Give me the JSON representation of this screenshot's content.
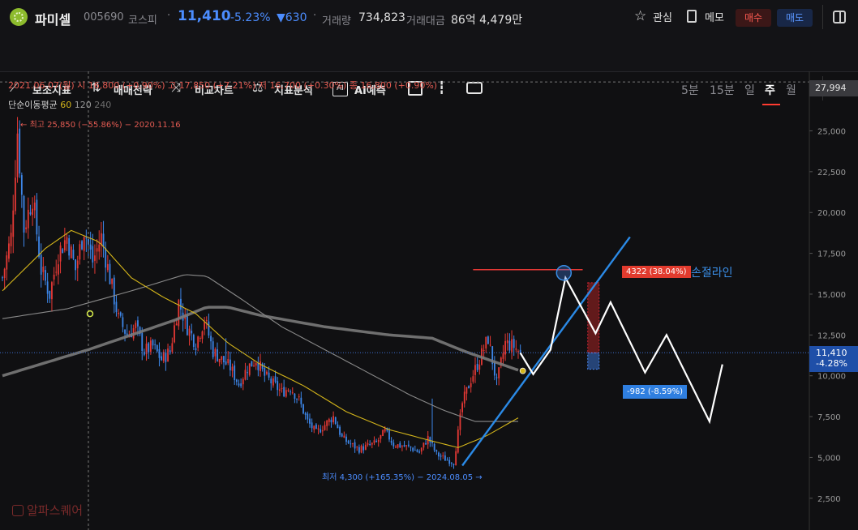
{
  "header": {
    "name": "파미셀",
    "code": "005690",
    "market": "코스피",
    "price": "11,410",
    "change_pct": "-5.23%",
    "change_abs": "▼630",
    "volume_label": "거래량",
    "volume": "734,823",
    "amount_label": "거래대금",
    "amount": "86억 4,479만",
    "watch_label": "관심",
    "memo_label": "메모",
    "buy_label": "매수",
    "sell_label": "매도"
  },
  "toolbar": {
    "items": [
      "보조지표",
      "매매전략",
      "비교차트",
      "지표분석",
      "AI예측"
    ],
    "periods": [
      "5분",
      "15분",
      "일",
      "주",
      "월"
    ],
    "active_period": "주"
  },
  "legend": {
    "ohlc": "2021.06.07(월)  시 16,800 (+0.90%)  고 17,850 (+7.21%)  저 16,700 (+0.30%)  종 16,800 (+0.90%)",
    "ma_label": "단순이동평균",
    "ma_periods": [
      "60",
      "120",
      "240"
    ]
  },
  "annotations": {
    "high_note": "최고 25,850 (−55.86%) − 2020.11.16",
    "low_note": "최저 4,300 (+165.35%) − 2024.08.05",
    "stop_label": "손절라인",
    "red_tag": "4322 (38.04%)",
    "blue_tag": "-982 (-8.59%)"
  },
  "price_tag": {
    "price": "11,410",
    "pct": "-4.28%"
  },
  "top_tag": "27,994",
  "watermark": "알파스퀘어",
  "colors": {
    "up": "#e53935",
    "down": "#3d86e8",
    "ma60": "#d4b51a",
    "ma120": "#8a8a8a",
    "ma240": "#7a7a7a",
    "trend": "#2b8ae6",
    "stop": "#e53935",
    "projection": "#ffffff"
  },
  "chart_data": {
    "type": "candlestick",
    "interval": "weekly",
    "y_axis": {
      "ticks": [
        2500,
        5000,
        7500,
        10000,
        12500,
        15000,
        17500,
        20000,
        22500,
        25000
      ],
      "range": [
        1200,
        28200
      ]
    },
    "crosshair": {
      "date": "2021.06.07",
      "price": 27994
    },
    "last_price": 11410,
    "all_time_high": {
      "price": 25850,
      "date": "2020.11.16"
    },
    "all_time_low": {
      "price": 4300,
      "date": "2024.08.05"
    },
    "close_path": [
      {
        "i": 0,
        "c": 16000
      },
      {
        "i": 4,
        "c": 18500
      },
      {
        "i": 7,
        "c": 25000
      },
      {
        "i": 10,
        "c": 19000
      },
      {
        "i": 14,
        "c": 21000
      },
      {
        "i": 18,
        "c": 16500
      },
      {
        "i": 22,
        "c": 15000
      },
      {
        "i": 26,
        "c": 17500
      },
      {
        "i": 30,
        "c": 18500
      },
      {
        "i": 34,
        "c": 16500
      },
      {
        "i": 38,
        "c": 19000
      },
      {
        "i": 42,
        "c": 17000
      },
      {
        "i": 46,
        "c": 18500
      },
      {
        "i": 50,
        "c": 16000
      },
      {
        "i": 54,
        "c": 13500
      },
      {
        "i": 58,
        "c": 12500
      },
      {
        "i": 62,
        "c": 13000
      },
      {
        "i": 66,
        "c": 11500
      },
      {
        "i": 70,
        "c": 11800
      },
      {
        "i": 74,
        "c": 11000
      },
      {
        "i": 78,
        "c": 11500
      },
      {
        "i": 82,
        "c": 14500
      },
      {
        "i": 86,
        "c": 13000
      },
      {
        "i": 90,
        "c": 12000
      },
      {
        "i": 94,
        "c": 13500
      },
      {
        "i": 98,
        "c": 11500
      },
      {
        "i": 102,
        "c": 11000
      },
      {
        "i": 106,
        "c": 10500
      },
      {
        "i": 110,
        "c": 9500
      },
      {
        "i": 114,
        "c": 10500
      },
      {
        "i": 118,
        "c": 11000
      },
      {
        "i": 122,
        "c": 10000
      },
      {
        "i": 126,
        "c": 9500
      },
      {
        "i": 130,
        "c": 9000
      },
      {
        "i": 134,
        "c": 9300
      },
      {
        "i": 138,
        "c": 8500
      },
      {
        "i": 142,
        "c": 7200
      },
      {
        "i": 146,
        "c": 6500
      },
      {
        "i": 150,
        "c": 7000
      },
      {
        "i": 154,
        "c": 7500
      },
      {
        "i": 158,
        "c": 6200
      },
      {
        "i": 162,
        "c": 5800
      },
      {
        "i": 166,
        "c": 5500
      },
      {
        "i": 170,
        "c": 5700
      },
      {
        "i": 174,
        "c": 5900
      },
      {
        "i": 178,
        "c": 6600
      },
      {
        "i": 182,
        "c": 5800
      },
      {
        "i": 186,
        "c": 5700
      },
      {
        "i": 190,
        "c": 5600
      },
      {
        "i": 194,
        "c": 5300
      },
      {
        "i": 198,
        "c": 6200
      },
      {
        "i": 202,
        "c": 5200
      },
      {
        "i": 206,
        "c": 4900
      },
      {
        "i": 210,
        "c": 4700
      },
      {
        "i": 214,
        "c": 8300
      },
      {
        "i": 218,
        "c": 9800
      },
      {
        "i": 222,
        "c": 11000
      },
      {
        "i": 226,
        "c": 12300
      },
      {
        "i": 230,
        "c": 9500
      },
      {
        "i": 234,
        "c": 12000
      },
      {
        "i": 238,
        "c": 11800
      },
      {
        "i": 241,
        "c": 11400
      }
    ],
    "ma60_path": [
      {
        "i": 0,
        "v": 15200
      },
      {
        "i": 20,
        "v": 17800
      },
      {
        "i": 32,
        "v": 18900
      },
      {
        "i": 45,
        "v": 18200
      },
      {
        "i": 60,
        "v": 16000
      },
      {
        "i": 75,
        "v": 14800
      },
      {
        "i": 90,
        "v": 13800
      },
      {
        "i": 105,
        "v": 12000
      },
      {
        "i": 120,
        "v": 10700
      },
      {
        "i": 140,
        "v": 9400
      },
      {
        "i": 160,
        "v": 7800
      },
      {
        "i": 180,
        "v": 6700
      },
      {
        "i": 200,
        "v": 6000
      },
      {
        "i": 212,
        "v": 5600
      },
      {
        "i": 225,
        "v": 6300
      },
      {
        "i": 241,
        "v": 7500
      }
    ],
    "ma120_path": [
      {
        "i": 0,
        "v": 13500
      },
      {
        "i": 30,
        "v": 14100
      },
      {
        "i": 60,
        "v": 15200
      },
      {
        "i": 85,
        "v": 16200
      },
      {
        "i": 95,
        "v": 16100
      },
      {
        "i": 110,
        "v": 14800
      },
      {
        "i": 130,
        "v": 13000
      },
      {
        "i": 150,
        "v": 11600
      },
      {
        "i": 170,
        "v": 10200
      },
      {
        "i": 190,
        "v": 8800
      },
      {
        "i": 205,
        "v": 7900
      },
      {
        "i": 220,
        "v": 7200
      },
      {
        "i": 241,
        "v": 7200
      }
    ],
    "ma240_path": [
      {
        "i": 0,
        "v": 10000
      },
      {
        "i": 20,
        "v": 10800
      },
      {
        "i": 40,
        "v": 11600
      },
      {
        "i": 60,
        "v": 12500
      },
      {
        "i": 80,
        "v": 13400
      },
      {
        "i": 95,
        "v": 14200
      },
      {
        "i": 105,
        "v": 14200
      },
      {
        "i": 120,
        "v": 13700
      },
      {
        "i": 150,
        "v": 13000
      },
      {
        "i": 180,
        "v": 12500
      },
      {
        "i": 200,
        "v": 12300
      },
      {
        "i": 215,
        "v": 11500
      },
      {
        "i": 241,
        "v": 10300
      }
    ],
    "trend_line": [
      {
        "i": 214,
        "v": 4500
      },
      {
        "i": 292,
        "v": 18500
      }
    ],
    "stop_line": {
      "from_i": 219,
      "to_i": 270,
      "v": 16500
    },
    "projection": [
      {
        "i": 241,
        "v": 11400
      },
      {
        "i": 247,
        "v": 10100
      },
      {
        "i": 255,
        "v": 11600
      },
      {
        "i": 262,
        "v": 16000
      },
      {
        "i": 276,
        "v": 12600
      },
      {
        "i": 283,
        "v": 14500
      },
      {
        "i": 299,
        "v": 10200
      },
      {
        "i": 309,
        "v": 12500
      },
      {
        "i": 329,
        "v": 7200
      },
      {
        "i": 335,
        "v": 10700
      }
    ],
    "red_box": {
      "i": 275,
      "from": 11400,
      "to": 15700
    },
    "blue_box": {
      "i": 275,
      "from": 11400,
      "to": 10400
    }
  }
}
